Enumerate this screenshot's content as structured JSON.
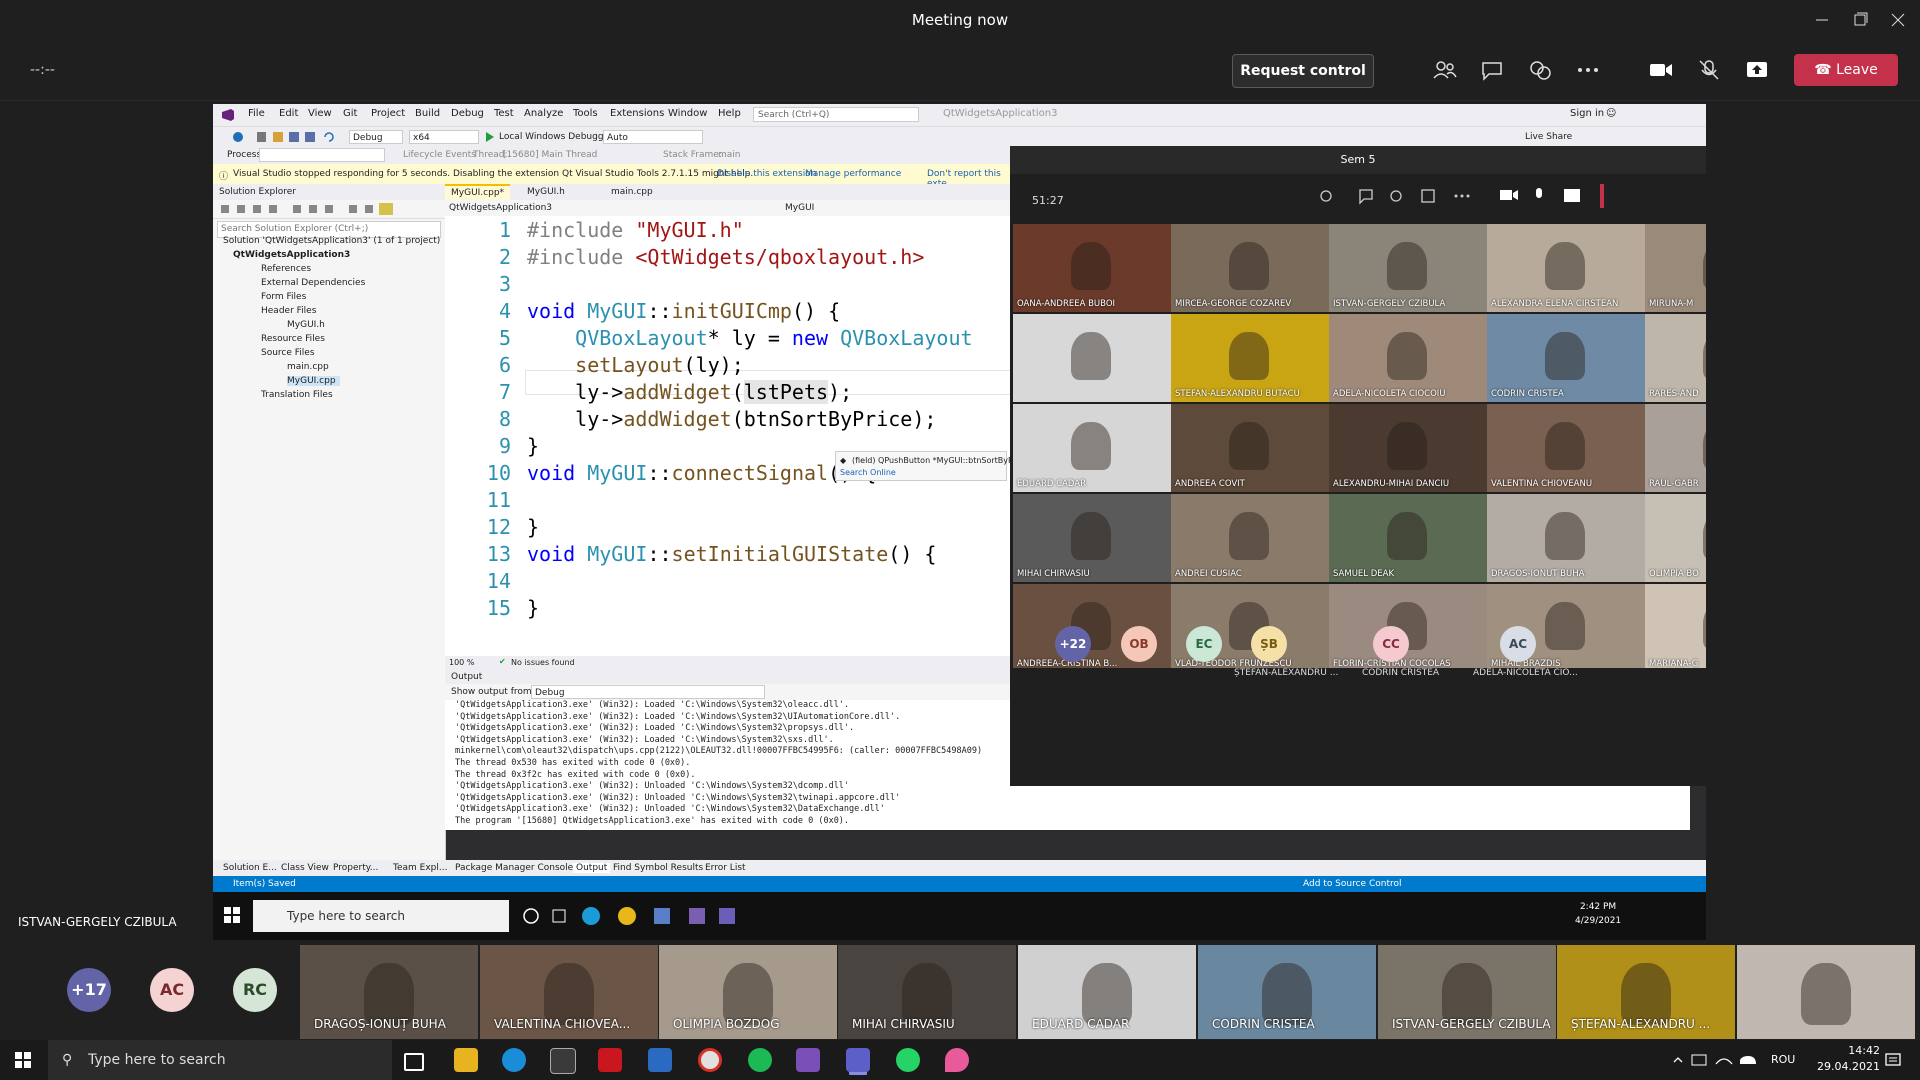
{
  "teams": {
    "title": "Meeting now",
    "timer": "--:--",
    "request_control": "Request control",
    "leave": "Leave",
    "presenter_name": "ISTVAN-GERGELY CZIBULA"
  },
  "vs": {
    "menu": [
      "File",
      "Edit",
      "View",
      "Git",
      "Project",
      "Build",
      "Debug",
      "Test",
      "Analyze",
      "Tools",
      "Extensions",
      "Window",
      "Help"
    ],
    "search_placeholder": "Search (Ctrl+Q)",
    "app_title": "QtWidgetsApplication3",
    "sign_in": "Sign in",
    "config": "Debug",
    "platform": "x64",
    "debugger": "Local Windows Debugger",
    "auto": "Auto",
    "live_share": "Live Share",
    "process_label": "Process:",
    "lifecycle": "Lifecycle Events",
    "thread_label": "Thread:",
    "thread_value": "[15680] Main Thread",
    "stack_label": "Stack Frame:",
    "stack_value": "main",
    "info_text": "Visual Studio stopped responding for 5 seconds. Disabling the extension Qt Visual Studio Tools 2.7.1.15 might help.",
    "info_disable": "Disable this extension",
    "info_manage": "Manage performance",
    "info_dont": "Don't report this exte",
    "solution_explorer": "Solution Explorer",
    "sol_search": "Search Solution Explorer (Ctrl+;)",
    "tree": {
      "solution": "Solution 'QtWidgetsApplication3' (1 of 1 project)",
      "project": "QtWidgetsApplication3",
      "references": "References",
      "external": "External Dependencies",
      "form": "Form Files",
      "header": "Header Files",
      "mygui_h": "MyGUI.h",
      "resource": "Resource Files",
      "source": "Source Files",
      "main_cpp": "main.cpp",
      "mygui_cpp": "MyGUI.cpp",
      "translation": "Translation Files"
    },
    "tabs": [
      "MyGUI.cpp*",
      "MyGUI.h",
      "main.cpp"
    ],
    "nav_left": "QtWidgetsApplication3",
    "nav_right": "MyGUI",
    "code_lines": [
      "1",
      "2",
      "3",
      "4",
      "5",
      "6",
      "7",
      "8",
      "9",
      "10",
      "11",
      "12",
      "13",
      "14",
      "15"
    ],
    "tooltip_field": "(field) QPushButton *MyGUI::btnSortByPrice",
    "tooltip_search": "Search Online",
    "zoom": "100 %",
    "issues": "No issues found",
    "output_title": "Output",
    "output_from_label": "Show output from:",
    "output_from_value": "Debug",
    "output_lines": [
      "'QtWidgetsApplication3.exe' (Win32): Loaded 'C:\\Windows\\System32\\oleacc.dll'.",
      "'QtWidgetsApplication3.exe' (Win32): Loaded 'C:\\Windows\\System32\\UIAutomationCore.dll'.",
      "'QtWidgetsApplication3.exe' (Win32): Loaded 'C:\\Windows\\System32\\propsys.dll'.",
      "'QtWidgetsApplication3.exe' (Win32): Loaded 'C:\\Windows\\System32\\sxs.dll'.",
      "minkernel\\com\\oleaut32\\dispatch\\ups.cpp(2122)\\OLEAUT32.dll!00007FFBC54995F6: (caller: 00007FFBC5498A09)",
      "The thread 0x530 has exited with code 0 (0x0).",
      "The thread 0x3f2c has exited with code 0 (0x0).",
      "'QtWidgetsApplication3.exe' (Win32): Unloaded 'C:\\Windows\\System32\\dcomp.dll'",
      "'QtWidgetsApplication3.exe' (Win32): Unloaded 'C:\\Windows\\System32\\twinapi.appcore.dll'",
      "'QtWidgetsApplication3.exe' (Win32): Unloaded 'C:\\Windows\\System32\\DataExchange.dll'",
      "The program '[15680] QtWidgetsApplication3.exe' has exited with code 0 (0x0)."
    ],
    "bottom_tabs": [
      "Solution E...",
      "Class View",
      "Property...",
      "Team Expl...",
      "Package Manager Console",
      "Output",
      "Find Symbol Results",
      "Error List"
    ],
    "status_left": "Item(s) Saved",
    "status_right": "Add to Source Control",
    "shared_search": "Type here to search",
    "shared_clock_time": "2:42 PM",
    "shared_clock_date": "4/29/2021"
  },
  "inner": {
    "title": "Sem 5",
    "timer": "51:27",
    "tiles": [
      {
        "name": "OANA-ANDREEA BUBOI",
        "color": "#6b3a2a"
      },
      {
        "name": "MIRCEA-GEORGE COZAREV",
        "color": "#7a6a5a"
      },
      {
        "name": "ISTVAN-GERGELY CZIBULA",
        "color": "#8a8578"
      },
      {
        "name": "ALEXANDRA ELENA CIRSTEAN",
        "color": "#b7aa9a"
      },
      {
        "name": "MIRUNA-M",
        "color": "#9a8a7a"
      },
      {
        "name": "",
        "color": "#d8d8d8"
      },
      {
        "name": "STEFAN-ALEXANDRU BUTACU",
        "color": "#c9a514"
      },
      {
        "name": "ADELA-NICOLETA CIOCOIU",
        "color": "#9f8a7a"
      },
      {
        "name": "CODRIN CRISTEA",
        "color": "#6e8aa4"
      },
      {
        "name": "RARES-AND",
        "color": "#bfb6aa"
      },
      {
        "name": "EDUARD CADAR",
        "color": "#d6d6d6"
      },
      {
        "name": "ANDREEA COVIT",
        "color": "#5d4a3a"
      },
      {
        "name": "ALEXANDRU-MIHAI DANCIU",
        "color": "#4a3a30"
      },
      {
        "name": "VALENTINA CHIOVEANU",
        "color": "#7a6050"
      },
      {
        "name": "RAUL-GABR",
        "color": "#a9a09a"
      },
      {
        "name": "MIHAI CHIRVASIU",
        "color": "#5a5a5a"
      },
      {
        "name": "ANDREI CUSIAC",
        "color": "#8a7a6a"
      },
      {
        "name": "SAMUEL DEAK",
        "color": "#5b6a52"
      },
      {
        "name": "DRAGOS-IONUT BUHA",
        "color": "#b3aca4"
      },
      {
        "name": "OLIMPIA BO",
        "color": "#c6bfb4"
      },
      {
        "name": "ANDREEA-CRISTINA B...",
        "color": "#6a5040"
      },
      {
        "name": "VLAD-TEODOR FRUNZESCU",
        "color": "#8b7b6b"
      },
      {
        "name": "FLORIN-CRISTIAN COCOLAS",
        "color": "#9a8a80"
      },
      {
        "name": "MIHAIL BRAZDIS",
        "color": "#a09080"
      },
      {
        "name": "MARIANA-G",
        "color": "#cfc3b6"
      }
    ],
    "more_count": "+22",
    "avatars": [
      {
        "initials": "OB",
        "name": ""
      },
      {
        "initials": "EC",
        "name": ""
      },
      {
        "initials": "ȘB",
        "name": "ȘTEFAN-ALEXANDRU ..."
      },
      {
        "initials": "CC",
        "name": "CODRIN CRISTEA"
      },
      {
        "initials": "AC",
        "name": "ADELA-NICOLETA CIO..."
      }
    ]
  },
  "strip": {
    "more_count": "+17",
    "avatars": [
      "AC",
      "RC"
    ],
    "tiles": [
      {
        "name": "DRAGOȘ-IONUȚ BUHA",
        "color": "#5a5048"
      },
      {
        "name": "VALENTINA CHIOVEA...",
        "color": "#6a5546"
      },
      {
        "name": "OLIMPIA BOZDOG",
        "color": "#a59a8c"
      },
      {
        "name": "MIHAI CHIRVASIU",
        "color": "#4a4440"
      },
      {
        "name": "EDUARD CADAR",
        "color": "#d0d0d0"
      },
      {
        "name": "CODRIN CRISTEA",
        "color": "#6a87a0"
      },
      {
        "name": "ISTVAN-GERGELY CZIBULA",
        "color": "#7a7468"
      },
      {
        "name": "ȘTEFAN-ALEXANDRU ...",
        "color": "#b09018"
      },
      {
        "name": "",
        "color": "#c0b8b0"
      }
    ]
  },
  "os": {
    "search": "Type here to search",
    "lang": "ROU",
    "time": "14:42",
    "date": "29.04.2021"
  },
  "colors": {
    "teams_bg": "#1f1f1f",
    "leave": "#c4314b",
    "vs_status": "#007acc"
  }
}
